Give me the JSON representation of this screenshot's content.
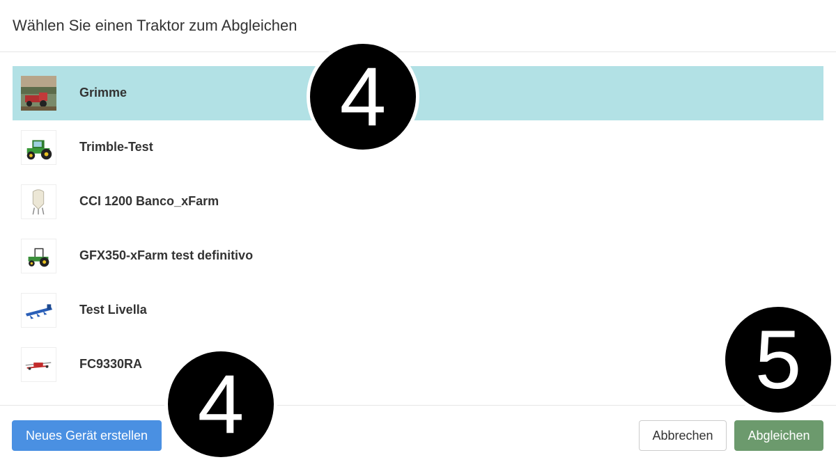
{
  "header": {
    "title": "Wählen Sie einen Traktor zum Abgleichen"
  },
  "devices": [
    {
      "name": "Grimme",
      "icon": "field-harvester-photo",
      "selected": true
    },
    {
      "name": "Trimble-Test",
      "icon": "green-tractor-icon",
      "selected": false
    },
    {
      "name": "CCI 1200 Banco_xFarm",
      "icon": "silo-icon",
      "selected": false
    },
    {
      "name": "GFX350-xFarm test definitivo",
      "icon": "green-tractor-small-icon",
      "selected": false
    },
    {
      "name": "Test Livella",
      "icon": "blue-plough-icon",
      "selected": false
    },
    {
      "name": "FC9330RA",
      "icon": "red-mower-icon",
      "selected": false
    }
  ],
  "footer": {
    "new_device_label": "Neues Gerät erstellen",
    "cancel_label": "Abbrechen",
    "match_label": "Abgleichen"
  },
  "callouts": {
    "top": "4",
    "bottom": "4",
    "right": "5"
  },
  "colors": {
    "selected_row": "#b2e1e5",
    "primary_button": "#4a90e2",
    "success_button": "#6c9a6d"
  }
}
